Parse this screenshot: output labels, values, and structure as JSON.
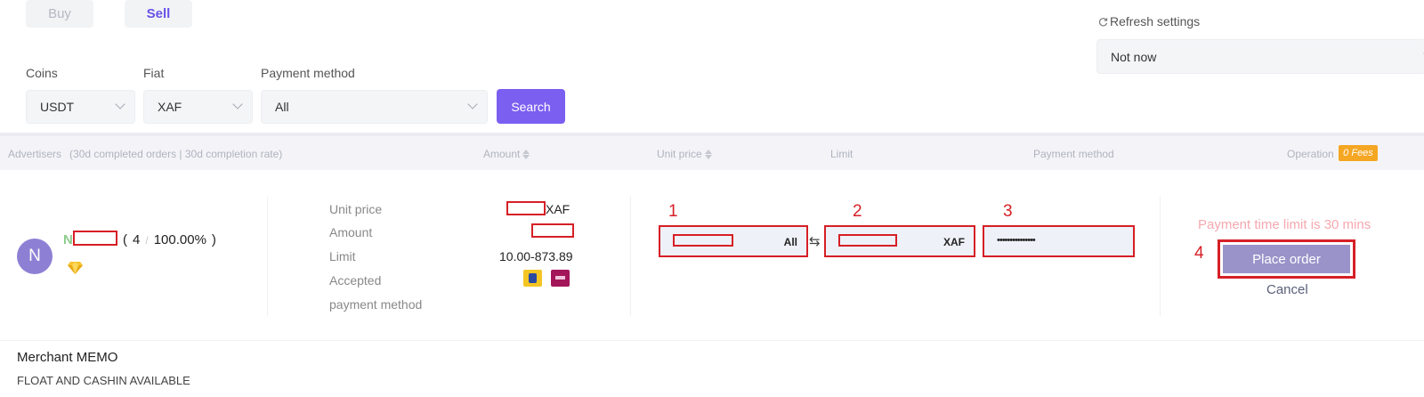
{
  "tabs": {
    "buy": "Buy",
    "sell": "Sell"
  },
  "filters": {
    "coins": {
      "label": "Coins",
      "value": "USDT"
    },
    "fiat": {
      "label": "Fiat",
      "value": "XAF"
    },
    "payment": {
      "label": "Payment method",
      "value": "All"
    },
    "search_label": "Search"
  },
  "refresh": {
    "label": "Refresh settings",
    "value": "Not now"
  },
  "table_header": {
    "advertisers": "Advertisers",
    "advertisers_sub": "(30d completed orders | 30d completion rate)",
    "amount": "Amount",
    "unit_price": "Unit price",
    "limit": "Limit",
    "payment_method": "Payment method",
    "operation": "Operation",
    "fees_badge": "0 Fees"
  },
  "advertiser": {
    "avatar_letter": "N",
    "name_initial": "N",
    "orders": "4",
    "separator": "/",
    "completion_rate": "100.00%",
    "paren_open": "(",
    "paren_close": ")"
  },
  "order_info": {
    "unit_price_label": "Unit price",
    "unit_price_currency": "XAF",
    "amount_label": "Amount",
    "limit_label": "Limit",
    "limit_value": "10.00-873.89",
    "accepted_label": "Accepted",
    "payment_method_label": "payment method"
  },
  "order_form": {
    "step1": "1",
    "step2": "2",
    "step3": "3",
    "step4": "4",
    "input1_suffix": "All",
    "input2_suffix": "XAF",
    "password_mask": "•••••••••••••••",
    "swap_symbol": "⇆"
  },
  "operation": {
    "time_limit_note": "Payment time limit is 30 mins",
    "place_order": "Place order",
    "cancel": "Cancel"
  },
  "memo": {
    "title": "Merchant MEMO",
    "text": "FLOAT AND CASHIN AVAILABLE"
  },
  "icons": {
    "refresh": "refresh-icon",
    "gem": "diamond-icon",
    "payment1": "mtn-momo-icon",
    "payment2": "orange-money-icon"
  },
  "colors": {
    "accent": "#7b5ff0",
    "highlight_red": "#d61f26",
    "fees": "#f5a623"
  }
}
